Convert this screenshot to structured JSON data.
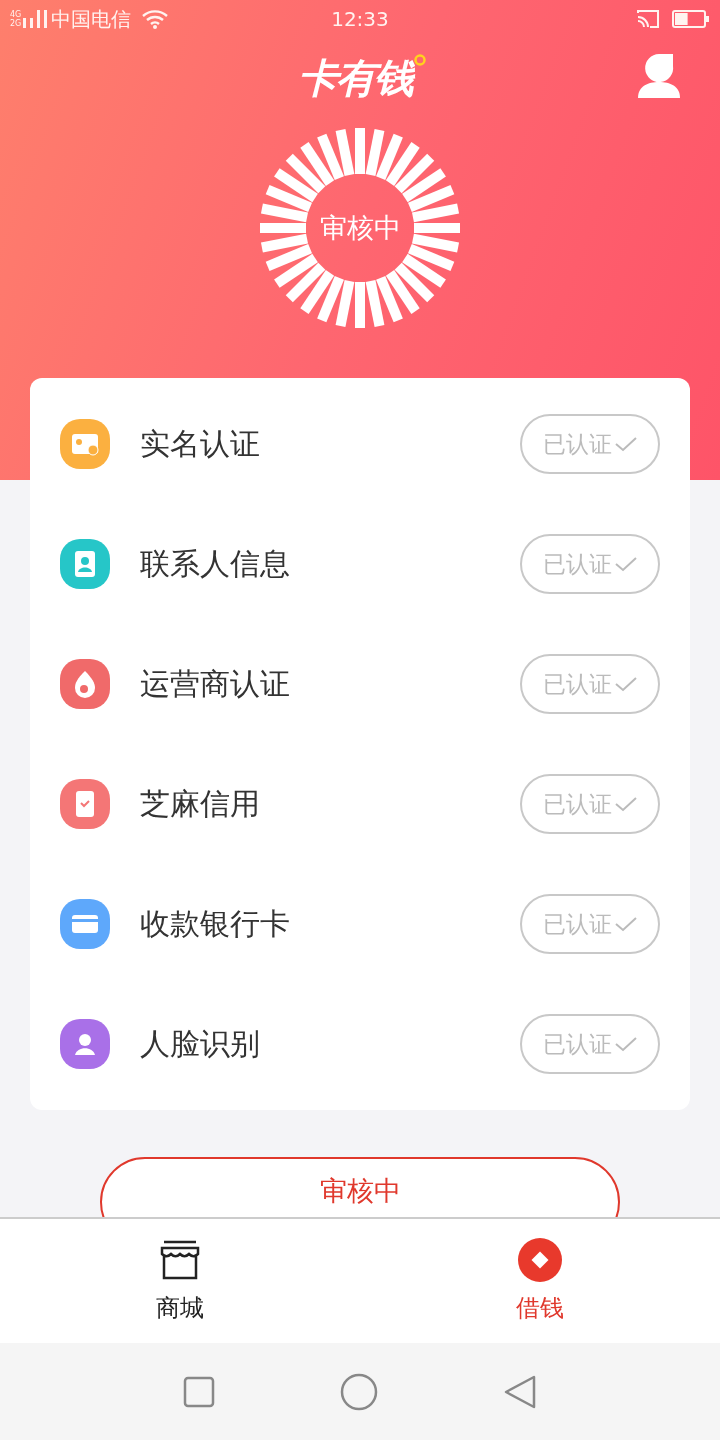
{
  "status_bar": {
    "network": [
      "4G",
      "2G"
    ],
    "carrier": "中国电信",
    "time": "12:33",
    "battery": {
      "level": 0.45
    }
  },
  "header": {
    "logo": "卡有钱",
    "status": "审核中"
  },
  "verifications": [
    {
      "label": "实名认证",
      "status": "已认证",
      "verified": true,
      "color": "#fbb040"
    },
    {
      "label": "联系人信息",
      "status": "已认证",
      "verified": true,
      "color": "#26c6c8"
    },
    {
      "label": "运营商认证",
      "status": "已认证",
      "verified": true,
      "color": "#f06a6a"
    },
    {
      "label": "芝麻信用",
      "status": "已认证",
      "verified": true,
      "color": "#f47676"
    },
    {
      "label": "收款银行卡",
      "status": "已认证",
      "verified": true,
      "color": "#5ea8fb"
    },
    {
      "label": "人脸识别",
      "status": "已认证",
      "verified": true,
      "color": "#a970e8"
    }
  ],
  "action_button": {
    "label": "审核中"
  },
  "tabs": [
    {
      "label": "商城",
      "selected": false
    },
    {
      "label": "借钱",
      "selected": true
    }
  ]
}
